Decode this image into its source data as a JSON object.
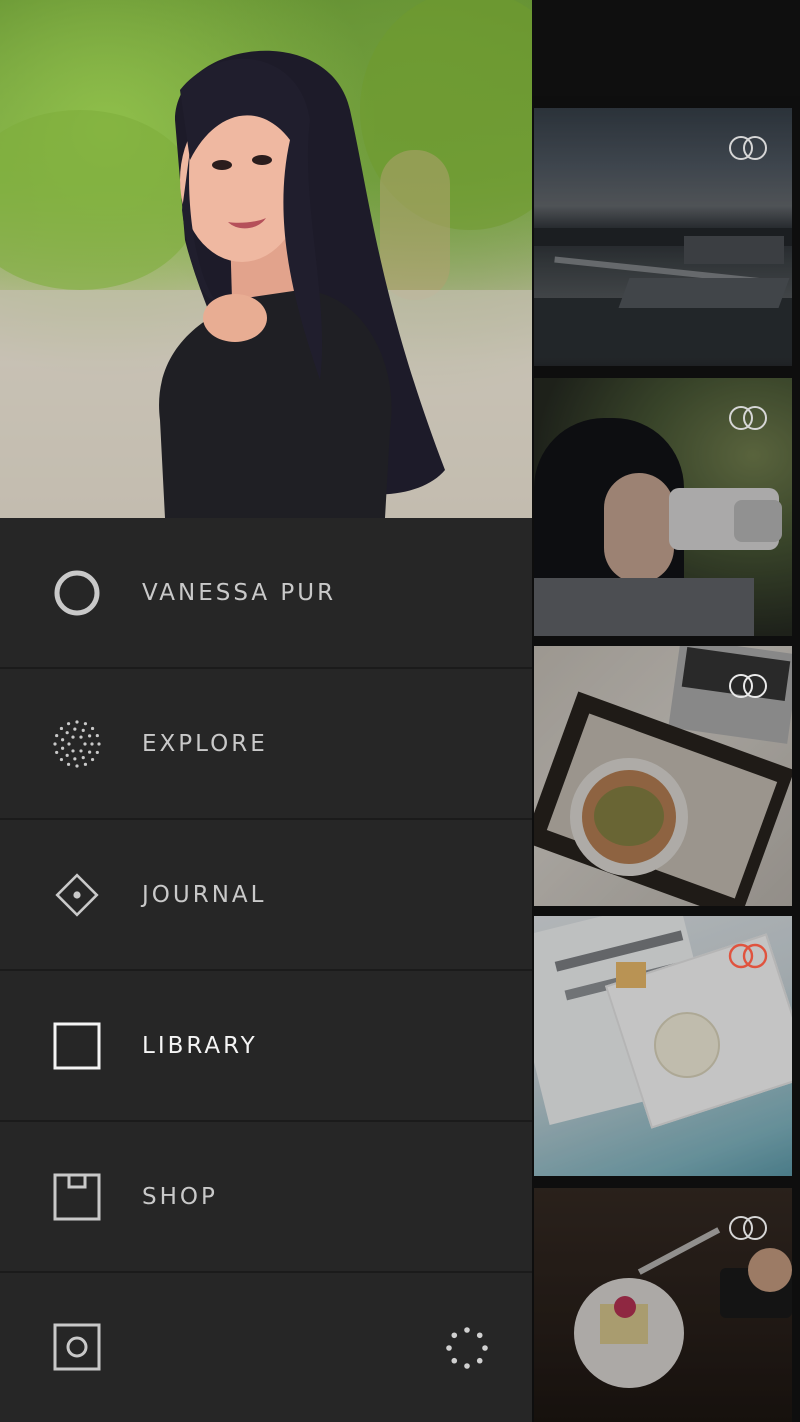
{
  "profile": {
    "name": "VANESSA PUR",
    "photo_alt": "profile photo"
  },
  "menu": {
    "items": [
      {
        "id": "profile",
        "label": "VANESSA PUR",
        "icon": "circle-icon",
        "active": false
      },
      {
        "id": "explore",
        "label": "EXPLORE",
        "icon": "dotted-circle-icon",
        "active": false
      },
      {
        "id": "journal",
        "label": "JOURNAL",
        "icon": "diamond-icon",
        "active": false
      },
      {
        "id": "library",
        "label": "LIBRARY",
        "icon": "square-icon",
        "active": true
      },
      {
        "id": "shop",
        "label": "SHOP",
        "icon": "box-icon",
        "active": false
      }
    ]
  },
  "bottom_bar": {
    "left_icon": "camera-icon",
    "right_icon": "loading-dots-icon"
  },
  "colors": {
    "drawer_bg": "#262626",
    "divider": "#1b1b1b",
    "label": "#c9c9c9",
    "label_active": "#f5f5f5",
    "strip_bg": "#0e0e0e"
  },
  "grid": {
    "thumbnails": [
      {
        "icon": "link-rings-icon"
      },
      {
        "icon": "link-rings-icon"
      },
      {
        "icon": "link-rings-icon"
      },
      {
        "icon": "link-rings-icon",
        "accent": "#e0533e"
      },
      {
        "icon": "link-rings-icon"
      }
    ]
  }
}
